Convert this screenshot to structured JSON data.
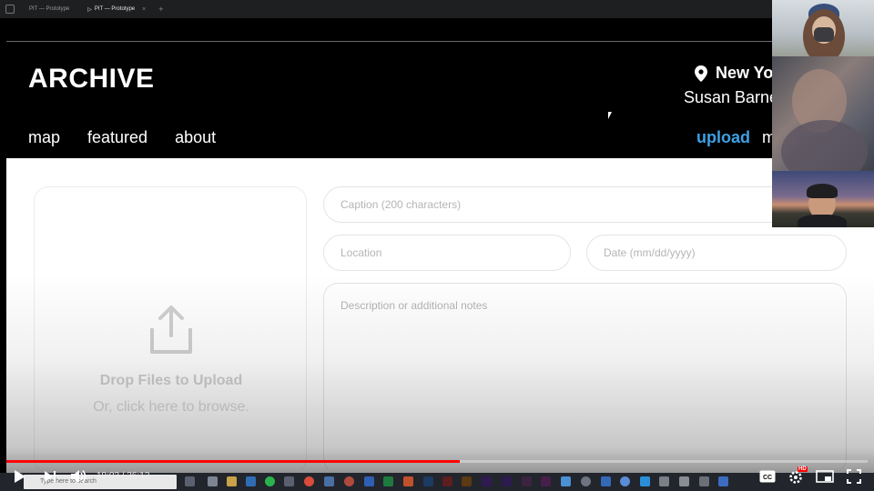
{
  "browser": {
    "tabs": [
      {
        "label": "PIT — Prototype",
        "active": false
      },
      {
        "label": "PIT — Prototype",
        "active": true
      }
    ],
    "new_tab_label": "+"
  },
  "app": {
    "logo": "ARCHIVE",
    "location": "New Yo",
    "user_name": "Susan Barne",
    "nav": [
      "map",
      "featured",
      "about"
    ],
    "upload_label": "upload",
    "more_label": "m",
    "accent_color": "#3ea0e5"
  },
  "upload_form": {
    "drop_title": "Drop Files to Upload",
    "drop_subtitle": "Or, click here to browse.",
    "caption_placeholder": "Caption (200 characters)",
    "location_placeholder": "Location",
    "date_placeholder": "Date (mm/dd/yyyy)",
    "description_placeholder": "Description or additional notes"
  },
  "player": {
    "current_time": "19:03",
    "duration": "36:12",
    "time_display": "19:03 / 36:12",
    "progress": 0.526,
    "progress_color": "#ff0000",
    "hd_badge": "HD"
  },
  "taskbar": {
    "search_placeholder": "Type here to search"
  }
}
